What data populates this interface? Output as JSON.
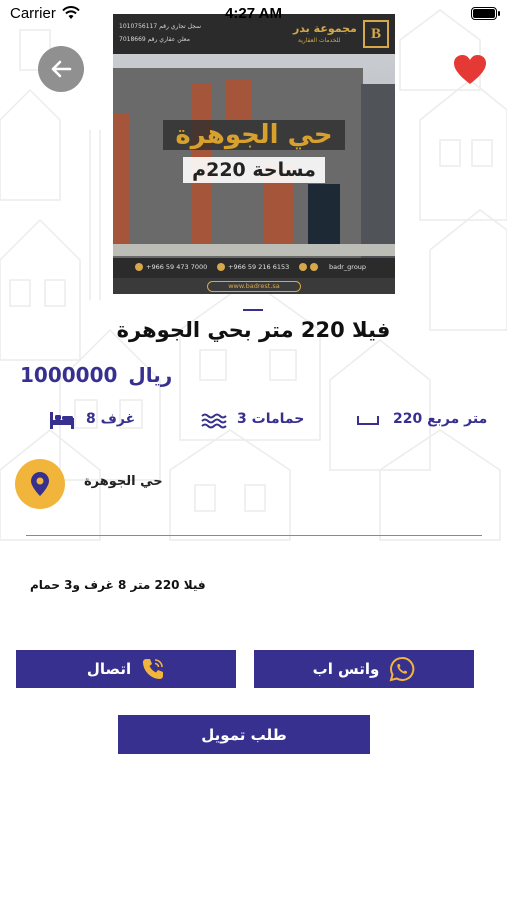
{
  "status_bar": {
    "carrier": "Carrier",
    "time": "4:27 AM"
  },
  "image": {
    "brand": "مجموعة بدر",
    "brand_sub": "للخدمات العقارية",
    "logo_letters": "B",
    "license_1": "سجل تجاري رقم 1010756117",
    "license_2": "معلن عقاري رقم 7018669",
    "headline": "حي الجوهرة",
    "area": "مساحة 220م",
    "phone_1": "+966 59 473 7000",
    "phone_2": "+966 59 216 6153",
    "handle": "badr_group",
    "website": "www.badrest.sa"
  },
  "listing": {
    "title": "فيلا 220 متر بحي الجوهرة",
    "price_currency": "ريال",
    "price_value": "1000000",
    "features": {
      "area": "متر مربع 220",
      "bathrooms": "حمامات 3",
      "rooms": "غرف 8"
    },
    "location": "حي الجوهرة",
    "description": "فيلا 220 متر 8 غرف و3 حمام"
  },
  "actions": {
    "call_label": "اتصال",
    "whatsapp_label": "واتس اب",
    "finance_label": "طلب تمويل"
  },
  "colors": {
    "accent": "#37308f",
    "location_badge": "#f2b53b",
    "favorite": "#e53935"
  },
  "icons": {
    "back": "arrow-left-icon",
    "favorite": "heart-icon",
    "area": "ruler-icon",
    "bathrooms": "water-waves-icon",
    "rooms": "bed-icon",
    "location": "map-pin-icon",
    "call": "phone-icon",
    "whatsapp": "whatsapp-icon"
  }
}
